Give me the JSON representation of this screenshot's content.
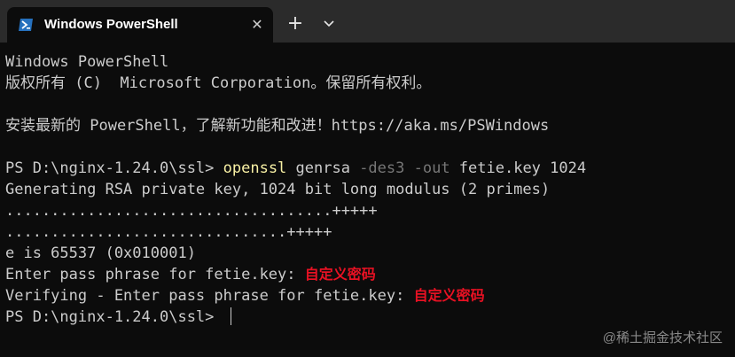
{
  "tab": {
    "title": "Windows PowerShell",
    "icon": "powershell-icon",
    "close_glyph": "✕"
  },
  "toolbar": {
    "new_tab_glyph": "+",
    "dropdown_icon": "chevron-down-icon"
  },
  "colors": {
    "background": "#0c0c0c",
    "titlebar": "#2b2b2b",
    "text": "#cccccc",
    "command": "#f9f1a5",
    "parameter": "#767676",
    "annotation": "#e81123",
    "icon_blue": "#2671be"
  },
  "terminal": {
    "line1": "Windows PowerShell",
    "line2": "版权所有 (C)  Microsoft Corporation。保留所有权利。",
    "line3": "安装最新的 PowerShell，了解新功能和改进！https://aka.ms/PSWindows",
    "prompt1": "PS D:\\nginx-1.24.0\\ssl> ",
    "cmd": "openssl",
    "arg_genrsa": " genrsa ",
    "param_des3": "-des3",
    "param_out": " -out",
    "arg_tail": " fetie.key 1024",
    "gen_line": "Generating RSA private key, 1024 bit long modulus (2 primes)",
    "dots1": "....................................+++++",
    "dots2": "...............................+++++",
    "e_line": "e is 65537 (0x010001)",
    "pass_prompt": "Enter pass phrase for fetie.key: ",
    "pass_annot": "自定义密码",
    "verify_prompt": "Verifying - Enter pass phrase for fetie.key: ",
    "verify_annot": "自定义密码",
    "prompt2": "PS D:\\nginx-1.24.0\\ssl> "
  },
  "watermark": "@稀土掘金技术社区"
}
